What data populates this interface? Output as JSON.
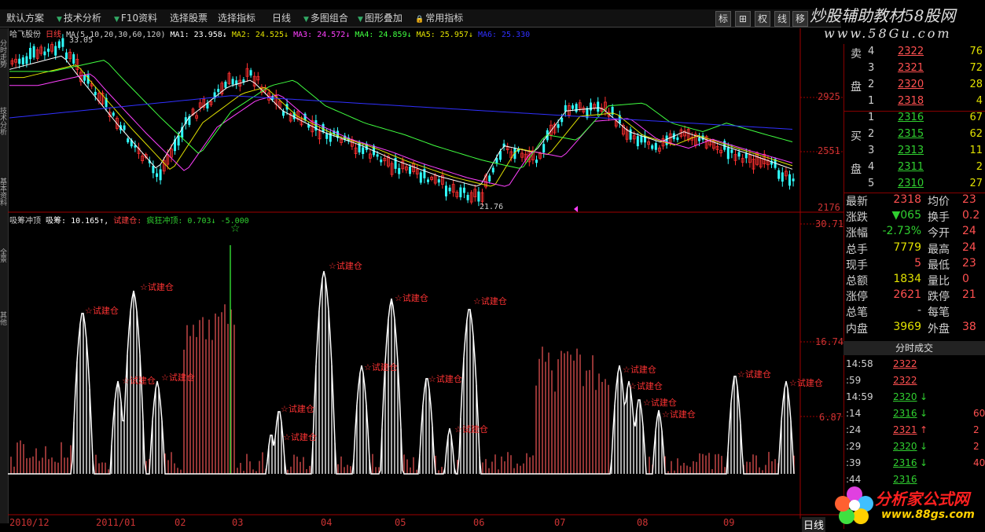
{
  "top_menu": [],
  "toolbar": {
    "items": [
      "默认方案",
      "技术分析",
      "F10资料",
      "选择股票",
      "选择指标",
      "日线",
      "多图组合",
      "图形叠加",
      "常用指标"
    ]
  },
  "right_toolbar": [
    "标",
    "⊞",
    "权",
    "线",
    "移"
  ],
  "watermark": {
    "line1": "炒股辅助教材58股网",
    "line2": "www.58Gu.com"
  },
  "left_rail": [
    "分时走势",
    "技术分析",
    "基本资料",
    "全景",
    "其他"
  ],
  "main_chart": {
    "stock_name": "哈飞股份",
    "period": "日线",
    "ma_params": "MA(5,10,20,30,60,120)",
    "ma1": "MA1: 23.958↓",
    "ma2": "MA2: 24.525↓",
    "ma3": "MA3: 24.572↓",
    "ma4": "MA4: 24.859↓",
    "ma5": "MA5: 25.957↓",
    "ma6": "MA6: 25.330",
    "high_label": "33.05",
    "low_label": "21.76",
    "yaxis": [
      "2925",
      "2551",
      "2176"
    ],
    "colors": {
      "up": "#ff3030",
      "down": "#30ffff",
      "ma1": "#ffffff",
      "ma2": "#e0e000",
      "ma3": "#ff40ff",
      "ma4": "#40ff40",
      "ma5": "#3030ff",
      "ma6": "#888888"
    }
  },
  "indicator": {
    "name": "吸筹冲顶",
    "v1": "吸筹: 10.165↑,",
    "v2": "试建仓:",
    "v3": "疯狂冲顶: 0.703↓",
    "v4": "-5.000",
    "yaxis": [
      "30.71",
      "16.74",
      "6.87"
    ],
    "annotation_label": "☆试建仓"
  },
  "xaxis": [
    "2010/12",
    "2011/01",
    "02",
    "03",
    "04",
    "05",
    "06",
    "07",
    "08",
    "09"
  ],
  "order_book": {
    "sell_label": [
      "卖",
      "盘"
    ],
    "buy_label": [
      "买",
      "盘"
    ],
    "sells": [
      {
        "level": "4",
        "price": "2322",
        "vol": "76"
      },
      {
        "level": "3",
        "price": "2321",
        "vol": "72"
      },
      {
        "level": "2",
        "price": "2320",
        "vol": "28"
      },
      {
        "level": "1",
        "price": "2318",
        "vol": "4"
      }
    ],
    "buys": [
      {
        "level": "1",
        "price": "2316",
        "vol": "67"
      },
      {
        "level": "2",
        "price": "2315",
        "vol": "62"
      },
      {
        "level": "3",
        "price": "2313",
        "vol": "11"
      },
      {
        "level": "4",
        "price": "2311",
        "vol": "2"
      },
      {
        "level": "5",
        "price": "2310",
        "vol": "27"
      }
    ]
  },
  "stats": [
    {
      "k": "最新",
      "v": "2318",
      "vc": "#ff5050",
      "k2": "均价",
      "v2": "23"
    },
    {
      "k": "涨跌",
      "v": "▼065",
      "vc": "#30d030",
      "k2": "换手",
      "v2": "0.2"
    },
    {
      "k": "涨幅",
      "v": "-2.73%",
      "vc": "#30d030",
      "k2": "今开",
      "v2": "24"
    },
    {
      "k": "总手",
      "v": "7779",
      "vc": "#e0e000",
      "k2": "最高",
      "v2": "24"
    },
    {
      "k": "现手",
      "v": "5",
      "vc": "#ff5050",
      "k2": "最低",
      "v2": "23"
    },
    {
      "k": "总额",
      "v": "1834",
      "vc": "#e0e000",
      "k2": "量比",
      "v2": "0"
    },
    {
      "k": "涨停",
      "v": "2621",
      "vc": "#ff5050",
      "k2": "跌停",
      "v2": "21"
    },
    {
      "k": "总笔",
      "v": "-",
      "vc": "#d0d0d0",
      "k2": "每笔",
      "v2": ""
    },
    {
      "k": "内盘",
      "v": "3969",
      "vc": "#e0e000",
      "k2": "外盘",
      "v2": "38"
    }
  ],
  "trades_header": "分时成交",
  "trades": [
    {
      "t": "14:58",
      "p": "2322",
      "pc": "#ff5050",
      "arrow": "",
      "q": ""
    },
    {
      "t": ":59",
      "p": "2322",
      "pc": "#ff5050",
      "arrow": "",
      "q": ""
    },
    {
      "t": "14:59",
      "p": "2320",
      "pc": "#30d030",
      "arrow": "↓",
      "q": ""
    },
    {
      "t": ":14",
      "p": "2316",
      "pc": "#30d030",
      "arrow": "↓",
      "q": "60"
    },
    {
      "t": ":24",
      "p": "2321",
      "pc": "#ff5050",
      "arrow": "↑",
      "q": "2"
    },
    {
      "t": ":29",
      "p": "2320",
      "pc": "#30d030",
      "arrow": "↓",
      "q": "2"
    },
    {
      "t": ":39",
      "p": "2316",
      "pc": "#30d030",
      "arrow": "↓",
      "q": "40"
    },
    {
      "t": ":44",
      "p": "2316",
      "pc": "#30d030",
      "arrow": "",
      "q": ""
    }
  ],
  "period_label": "日线",
  "logo": {
    "text": "分析家公式网",
    "url": "www.88gs.com"
  }
}
